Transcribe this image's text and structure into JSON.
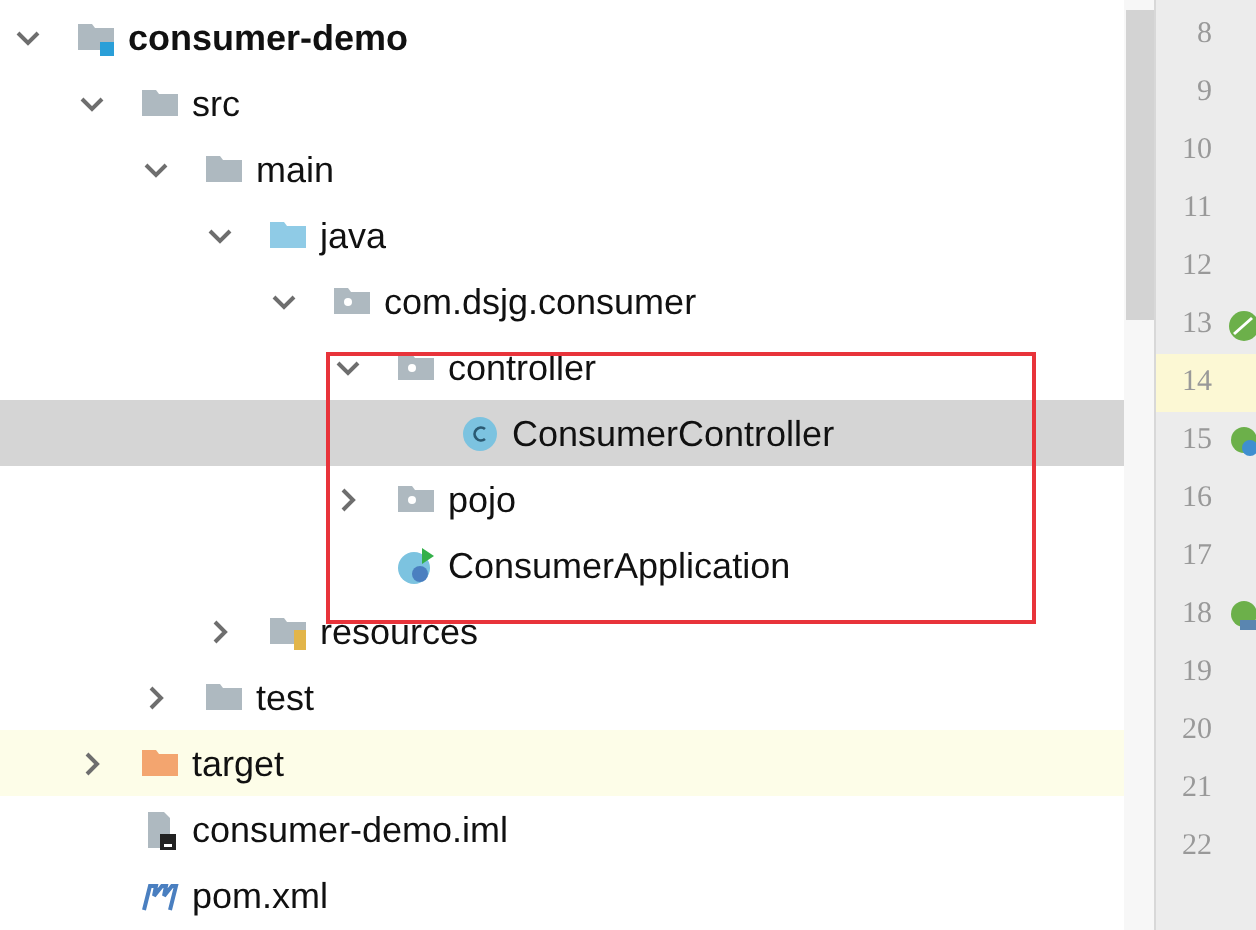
{
  "tree": [
    {
      "name": "consumer-demo",
      "kind": "module",
      "bold": true,
      "expanded": true,
      "selected": false,
      "children": [
        {
          "name": "src",
          "kind": "folder",
          "expanded": true,
          "selected": false,
          "children": [
            {
              "name": "main",
              "kind": "folder",
              "expanded": true,
              "selected": false,
              "children": [
                {
                  "name": "java",
                  "kind": "source_folder",
                  "expanded": true,
                  "selected": false,
                  "children": [
                    {
                      "name": "com.dsjg.consumer",
                      "kind": "package",
                      "expanded": true,
                      "selected": false,
                      "children": [
                        {
                          "name": "controller",
                          "kind": "package",
                          "expanded": true,
                          "selected": false,
                          "children": [
                            {
                              "name": "ConsumerController",
                              "kind": "class",
                              "selected": true
                            }
                          ]
                        },
                        {
                          "name": "pojo",
                          "kind": "package",
                          "expanded": false,
                          "selected": false
                        },
                        {
                          "name": "ConsumerApplication",
                          "kind": "spring_app",
                          "selected": false
                        }
                      ]
                    }
                  ]
                },
                {
                  "name": "resources",
                  "kind": "resources",
                  "expanded": false,
                  "selected": false
                }
              ]
            },
            {
              "name": "test",
              "kind": "folder",
              "expanded": false,
              "selected": false
            }
          ]
        },
        {
          "name": "target",
          "kind": "excluded_folder",
          "expanded": false,
          "selected": false,
          "excluded": true
        },
        {
          "name": "consumer-demo.iml",
          "kind": "iml",
          "selected": false
        },
        {
          "name": "pom.xml",
          "kind": "maven",
          "selected": false
        }
      ]
    }
  ],
  "gutter": [
    {
      "number": "8",
      "kind": "plain",
      "current": false
    },
    {
      "number": "9",
      "kind": "plain",
      "current": false
    },
    {
      "number": "10",
      "kind": "plain",
      "current": false
    },
    {
      "number": "11",
      "kind": "plain",
      "current": false
    },
    {
      "number": "12",
      "kind": "plain",
      "current": false
    },
    {
      "number": "13",
      "kind": "bean",
      "current": false
    },
    {
      "number": "14",
      "kind": "plain",
      "current": true
    },
    {
      "number": "15",
      "kind": "bean_link",
      "current": false
    },
    {
      "number": "16",
      "kind": "plain",
      "current": false
    },
    {
      "number": "17",
      "kind": "plain",
      "current": false
    },
    {
      "number": "18",
      "kind": "bean_run",
      "current": false
    },
    {
      "number": "19",
      "kind": "plain",
      "current": false
    },
    {
      "number": "20",
      "kind": "plain",
      "current": false
    },
    {
      "number": "21",
      "kind": "plain",
      "current": false
    },
    {
      "number": "22",
      "kind": "plain",
      "current": false
    }
  ]
}
